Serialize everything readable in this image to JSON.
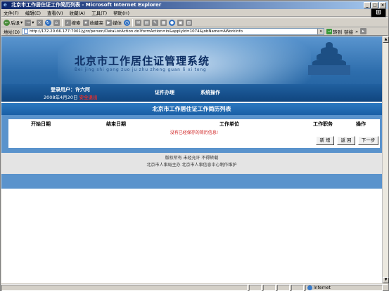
{
  "window": {
    "title": "北京市工作居住证工作简历列表 - Microsoft Internet Explorer"
  },
  "menu": [
    "文件(F)",
    "编辑(E)",
    "查看(V)",
    "收藏(A)",
    "工具(T)",
    "帮助(H)"
  ],
  "toolbar": {
    "back": "后退",
    "search": "搜索",
    "favorites": "收藏夹",
    "media": "媒体"
  },
  "address": {
    "label": "地址(D)",
    "url": "http://172.20.66.177:7001/yjrz/person/DataListAction.do?formAction=in&applyId=1074&jobName=AWorkInfo",
    "go_label": "转到",
    "links_label": "链接"
  },
  "banner": {
    "title": "北京市工作居住证管理系统",
    "pinyin": "Bei jing shi gong zuo ju zhu zheng guan li xi tong",
    "login_prefix": "登录用户：",
    "user": "许六阿",
    "date": "2008年4月20日",
    "logout": "安全退出",
    "nav": [
      "证件办理",
      "系统操作"
    ]
  },
  "page_title": "北京市工作居住证工作简历列表",
  "table": {
    "columns": [
      "开始日期",
      "结束日期",
      "工作单位",
      "工作职务",
      "操作"
    ],
    "empty_message": "没有已经保存的简历信息!"
  },
  "buttons": {
    "add": "新 增",
    "back": "返 回",
    "next": "下一步"
  },
  "footer": {
    "line1": "版权所有  未经允许  不得转载",
    "line2": "北京市人事局主办  北京市人事信息中心制作维护"
  },
  "statusbar": {
    "zone": "Internet"
  }
}
